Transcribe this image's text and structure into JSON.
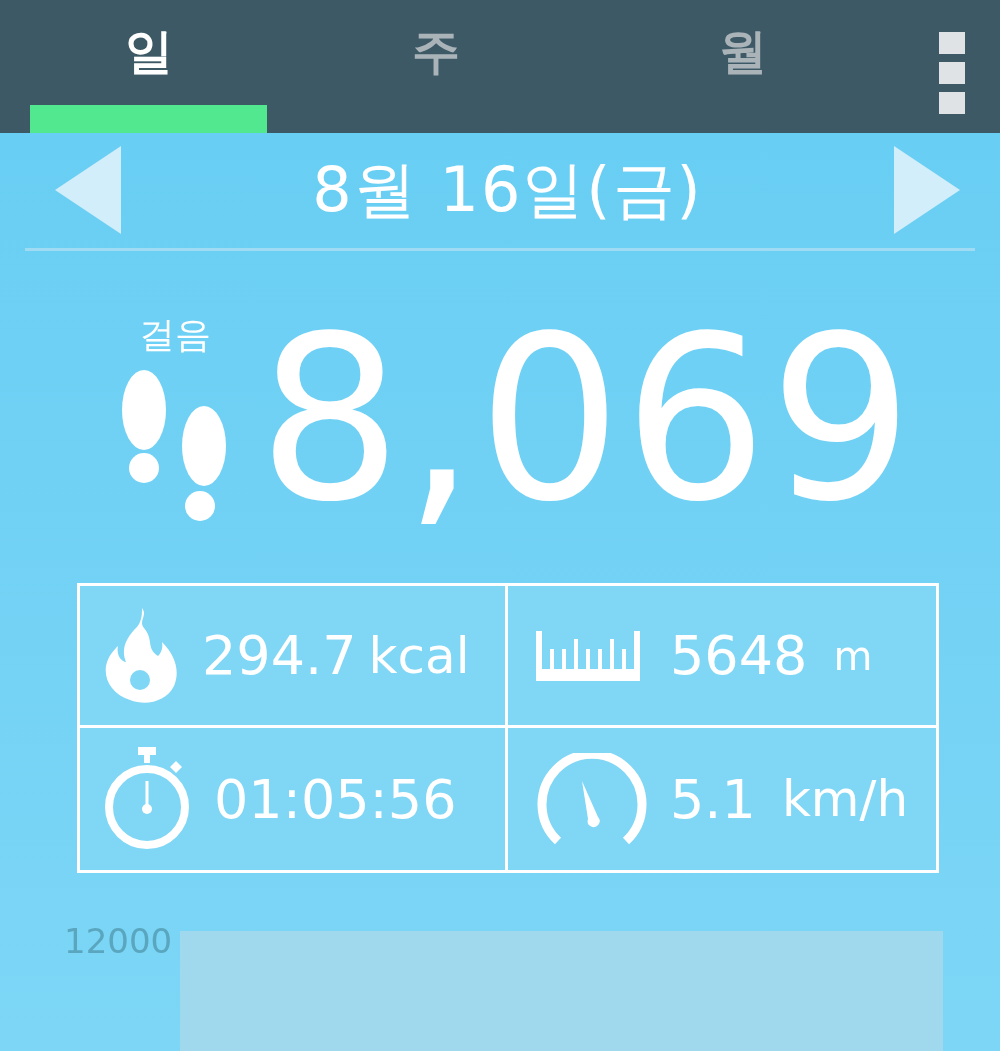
{
  "tabs": [
    {
      "label": "일",
      "selected": true
    },
    {
      "label": "주",
      "selected": false
    },
    {
      "label": "월",
      "selected": false
    }
  ],
  "date": "8월 16일(금)",
  "steps": {
    "label": "걸음",
    "count": "8,069"
  },
  "stats": [
    {
      "kind": "calories",
      "value": "294.7",
      "unit": "kcal"
    },
    {
      "kind": "distance",
      "value": "5648",
      "unit": "m"
    },
    {
      "kind": "time",
      "value": "01:05:56"
    },
    {
      "kind": "speed",
      "value": "5.1",
      "unit": "km/h"
    }
  ],
  "chart": {
    "y_tick": "12000"
  }
}
